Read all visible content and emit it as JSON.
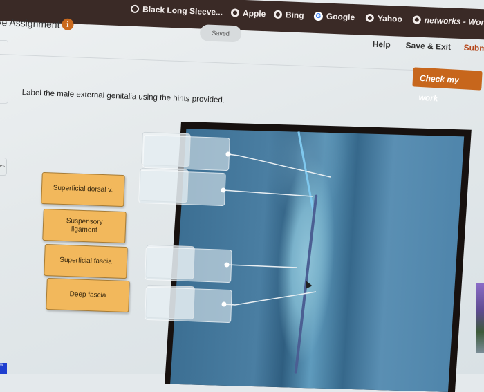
{
  "browser": {
    "bookmarks": [
      {
        "label": "Black Long Sleeve...",
        "icon": "circle-icon"
      },
      {
        "label": "Apple",
        "icon": "globe-icon"
      },
      {
        "label": "Bing",
        "icon": "globe-icon"
      },
      {
        "label": "Google",
        "icon": "google-icon"
      },
      {
        "label": "Yahoo",
        "icon": "globe-icon"
      },
      {
        "label": "networks - Worl",
        "icon": "globe-icon"
      }
    ]
  },
  "header": {
    "title": "ve Assignment",
    "info_icon": "i",
    "status": "Saved",
    "help": "Help",
    "save_exit": "Save & Exit",
    "submit": "Subm"
  },
  "check_button": "Check my work",
  "left_chip": "es",
  "left_blue": "w",
  "instruction": "Label the male external genitalia using the hints provided.",
  "labels": [
    {
      "text": "Superficial dorsal v."
    },
    {
      "text": "Suspensory ligament"
    },
    {
      "text": "Superficial fascia"
    },
    {
      "text": "Deep fascia"
    }
  ],
  "drop_targets": [
    {
      "value": ""
    },
    {
      "value": ""
    },
    {
      "value": ""
    },
    {
      "value": ""
    }
  ],
  "colors": {
    "accent": "#c7661c",
    "label_bg": "#f2b85c",
    "bookmark_bar": "#3a2a26"
  }
}
